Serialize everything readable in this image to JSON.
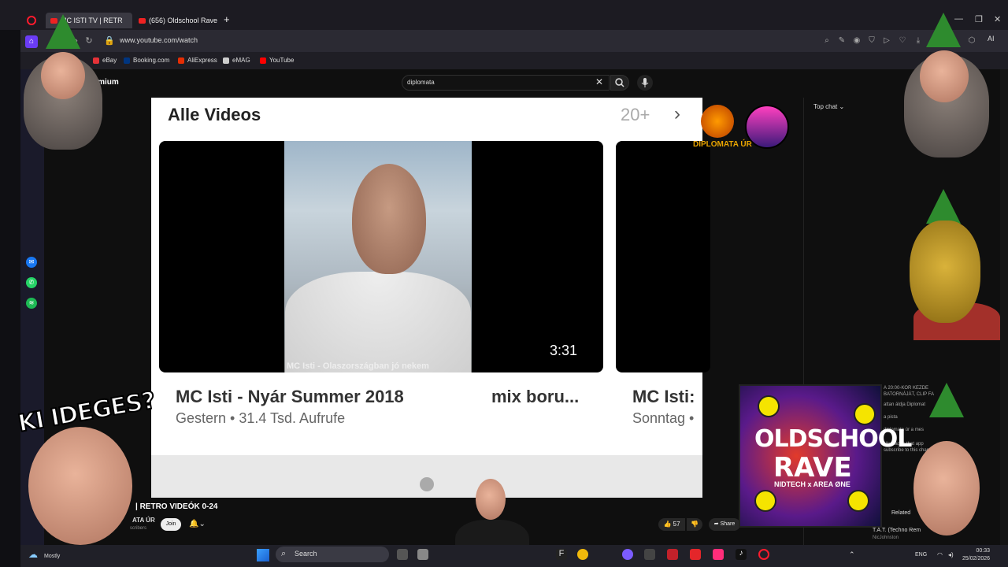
{
  "browser": {
    "tabs": [
      {
        "label": "MC ISTI TV | RETR"
      },
      {
        "label": "(656) Oldschool Rave"
      }
    ],
    "new_tab_label": "+",
    "url": "www.youtube.com/watch",
    "ai_label": "AI",
    "bookmarks": [
      {
        "label": "eBay",
        "color": "#e53238"
      },
      {
        "label": "Booking.com",
        "color": "#003580"
      },
      {
        "label": "AliExpress",
        "color": "#e62e04"
      },
      {
        "label": "eMAG",
        "color": "#cccccc"
      },
      {
        "label": "YouTube",
        "color": "#ff0000"
      }
    ]
  },
  "youtube": {
    "logo_text": "Premium",
    "search_value": "diplomata",
    "player": {
      "section_title": "Alle Videos",
      "count": "20+",
      "caption": "MC Isti - Olaszországban jó nekem",
      "duration": "3:31",
      "video1_title": "MC Isti - Nyár Summer 2018",
      "video1_meta": "Gestern • 31.4 Tsd. Aufrufe",
      "video2_title": "mix boru...",
      "video3_title": "MC Isti:",
      "video3_meta": "Sonntag •"
    },
    "overlay_logo": "DIPLOMATA ÚR",
    "chat": {
      "top_chat_label": "Top chat",
      "lines": [
        "A 20:00-KOR KEZDE",
        "BATORNÁJÁT, CLIP FA",
        "attan áldja Diplomat",
        "a pista",
        "diplomata úr a mes",
        "Messages that app",
        "subscribe to this chan"
      ],
      "related_label": "Related",
      "related_item": "T.A.T. (Techno Rem",
      "related_channel": "NicJohnston"
    },
    "video_title": "| RETRO VIDEÓK 0-24",
    "channel_name": "ATA ÚR",
    "subscribers": "scribers",
    "join_label": "Join",
    "likes": "57",
    "share_label": "Share"
  },
  "overlay_text": "KI IDEGES?",
  "album": {
    "line1": "OLDSCHOOL",
    "line2": "RAVE",
    "line3": "NIDTECH x AREA ØNE"
  },
  "taskbar": {
    "weather": "Mostly",
    "search_placeholder": "Search",
    "language": "ENG",
    "time": "00:33",
    "date": "25/02/2026"
  }
}
